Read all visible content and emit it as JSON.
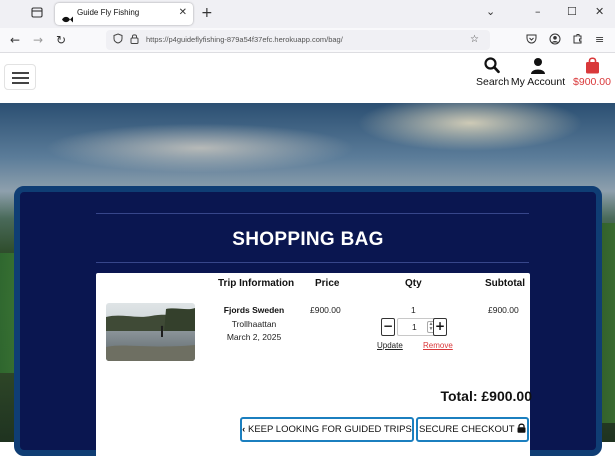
{
  "browser": {
    "tab_title": "Guide Fly Fishing",
    "tab_close_icon": "close-icon",
    "new_tab_icon": "plus-icon",
    "url": "https://p4guideflyfishing-879a54f37efc.herokuapp.com/bag/"
  },
  "header": {
    "search_label": "Search",
    "account_label": "My Account",
    "bag_total": "$900.00",
    "brand_color": "#d9383a"
  },
  "bag": {
    "title": "SHOPPING BAG",
    "columns": {
      "trip_info": "Trip Information",
      "price": "Price",
      "qty": "Qty",
      "subtotal": "Subtotal"
    },
    "items": [
      {
        "name": "Fjords Sweden",
        "location": "Trollhaattan",
        "date": "March 2, 2025",
        "price": "£900.00",
        "qty": "1",
        "qty_input": "1",
        "subtotal": "£900.00",
        "update_label": "Update",
        "remove_label": "Remove"
      }
    ],
    "total": "Total: £900.00",
    "keep_looking_label": "KEEP LOOKING FOR GUIDED TRIPS",
    "checkout_label": "SECURE CHECKOUT",
    "panel_color": "#0a1650",
    "accent_color": "#1b7fbf",
    "remove_color": "#d9383a"
  }
}
